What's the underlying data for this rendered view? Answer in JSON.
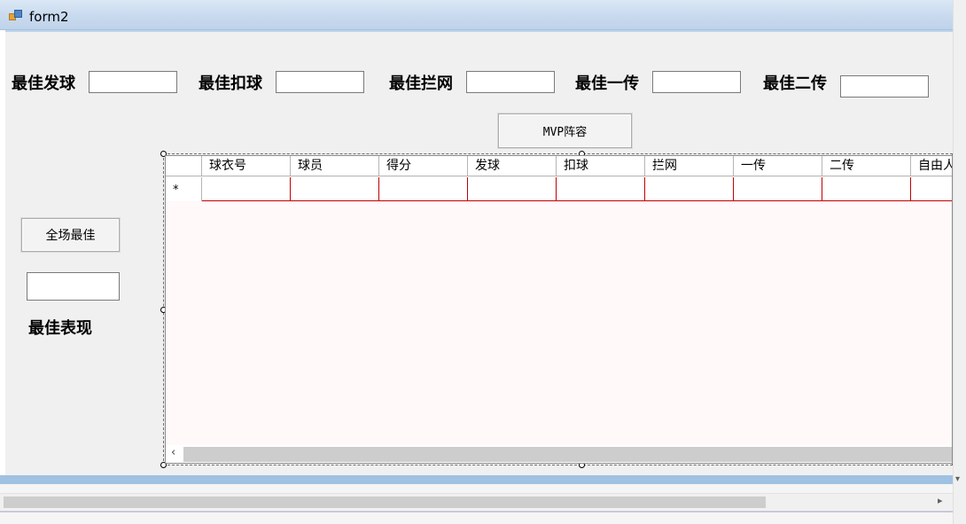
{
  "window": {
    "title": "form2"
  },
  "labels": {
    "best_serve": "最佳发球",
    "best_spike": "最佳扣球",
    "best_block": "最佳拦网",
    "best_first_pass": "最佳一传",
    "best_second_pass": "最佳二传",
    "best_performance": "最佳表现"
  },
  "inputs": {
    "best_serve": "",
    "best_spike": "",
    "best_block": "",
    "best_first_pass": "",
    "best_second_pass": "",
    "best_overall": ""
  },
  "buttons": {
    "mvp_lineup": "MVP阵容",
    "overall_best": "全场最佳"
  },
  "grid": {
    "columns": [
      "球衣号",
      "球员",
      "得分",
      "发球",
      "扣球",
      "拦网",
      "一传",
      "二传",
      "自由人"
    ],
    "new_row_marker": "*"
  },
  "icons": {
    "grid_scroll_left": "‹",
    "designer_scroll_right": "▸",
    "designer_scroll_down": "▾"
  }
}
